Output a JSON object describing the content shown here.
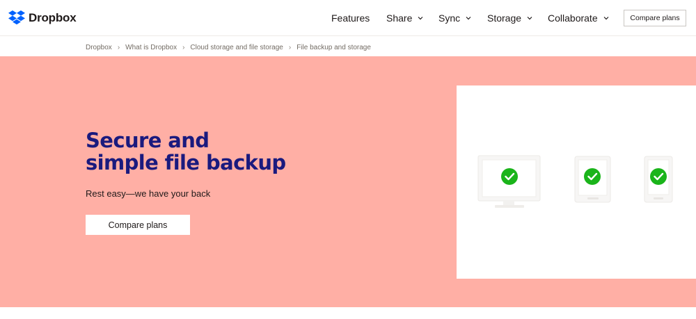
{
  "brand": {
    "name": "Dropbox",
    "color": "#0061fe"
  },
  "nav": {
    "features": "Features",
    "share": "Share",
    "sync": "Sync",
    "storage": "Storage",
    "collaborate": "Collaborate",
    "compare_plans": "Compare plans"
  },
  "breadcrumb": [
    "Dropbox",
    "What is Dropbox",
    "Cloud storage and file storage",
    "File backup and storage"
  ],
  "hero": {
    "title_line1": "Secure and",
    "title_line2": "simple file backup",
    "subtitle": "Rest easy—we have your back",
    "cta": "Compare plans",
    "background": "#ffafa5",
    "title_color": "#1a1a7e"
  },
  "illustration": {
    "devices": [
      "monitor-icon",
      "tablet-icon",
      "phone-icon"
    ],
    "status_icon": "check-circle-icon",
    "check_color": "#1ab41a"
  }
}
